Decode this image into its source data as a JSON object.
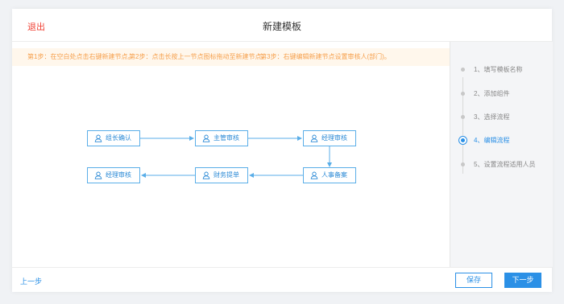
{
  "header": {
    "exit_label": "退出",
    "title": "新建模板"
  },
  "tips": {
    "step1": "第1步：在空白处点击右键新建节点。",
    "step2": "第2步：点击长按上一节点图标拖动至新建节点。",
    "step3": "第3步：右键编辑新建节点设置审核人(部门)。"
  },
  "flow": {
    "nodes": [
      {
        "label": "组长确认"
      },
      {
        "label": "主管审核"
      },
      {
        "label": "经理审核"
      },
      {
        "label": "人事备案"
      },
      {
        "label": "财务提单"
      },
      {
        "label": "经理审核"
      }
    ]
  },
  "steps": [
    {
      "label": "1、填写模板名称",
      "active": false
    },
    {
      "label": "2、添加组件",
      "active": false
    },
    {
      "label": "3、选择流程",
      "active": false
    },
    {
      "label": "4、编辑流程",
      "active": true
    },
    {
      "label": "5、设置流程适用人员",
      "active": false
    }
  ],
  "footer": {
    "prev_label": "上一步",
    "save_label": "保存",
    "next_label": "下一步"
  },
  "colors": {
    "accent": "#2b90e6",
    "exit": "#f04134",
    "tip_text": "#f6a04d",
    "tip_bg": "#fff7ec",
    "node_border": "#5aaee8"
  }
}
